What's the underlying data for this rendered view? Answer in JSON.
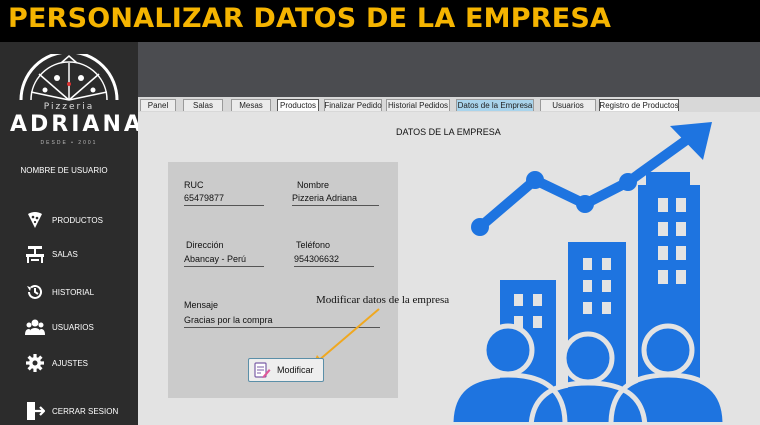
{
  "banner": {
    "title": "PERSONALIZAR DATOS DE LA EMPRESA"
  },
  "logo": {
    "small": "Pizzeria",
    "big": "ADRIANA",
    "tiny": "DESDE • 2001"
  },
  "sidebar": {
    "username": "NOMBRE DE USUARIO",
    "items": [
      {
        "label": "PRODUCTOS",
        "icon": "pizza-slice-icon"
      },
      {
        "label": "SALAS",
        "icon": "dining-table-icon"
      },
      {
        "label": "HISTORIAL",
        "icon": "history-icon"
      },
      {
        "label": "USUARIOS",
        "icon": "users-icon"
      },
      {
        "label": "AJUSTES",
        "icon": "gear-icon"
      },
      {
        "label": "CERRAR SESION",
        "icon": "logout-icon"
      }
    ]
  },
  "tabs": [
    {
      "label": "Panel"
    },
    {
      "label": "Salas"
    },
    {
      "label": "Mesas"
    },
    {
      "label": "Productos"
    },
    {
      "label": "Finalizar Pedido"
    },
    {
      "label": "Historial Pedidos"
    },
    {
      "label": "Datos de la Empresa"
    },
    {
      "label": "Usuarios"
    },
    {
      "label": "Registro de Productos"
    }
  ],
  "form": {
    "title": "DATOS DE LA EMPRESA",
    "ruc_label": "RUC",
    "ruc_value": "65479877",
    "nombre_label": "Nombre",
    "nombre_value": "Pizzeria Adriana",
    "direccion_label": "Dirección",
    "direccion_value": "Abancay - Perú",
    "telefono_label": "Teléfono",
    "telefono_value": "954306632",
    "mensaje_label": "Mensaje",
    "mensaje_value": "Gracias por la compra",
    "modificar_label": "Modificar"
  },
  "annotation": "Modificar datos de la empresa",
  "colors": {
    "banner_text": "#f5b400",
    "active_tab": "#a9d4ec",
    "illustration": "#1e74e0",
    "arrow": "#f0a820"
  }
}
